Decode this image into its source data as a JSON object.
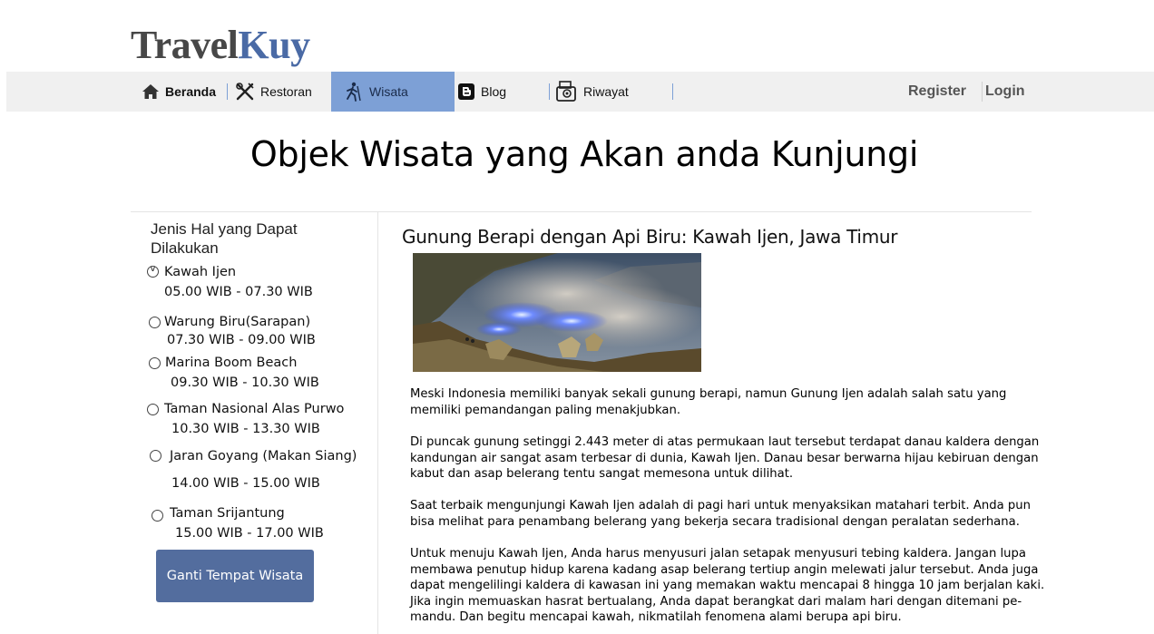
{
  "brand": {
    "first": "Travel",
    "second": "Kuy"
  },
  "nav": {
    "home": "Beranda",
    "restaurant": "Restoran",
    "tour": "Wisata",
    "blog": "Blog",
    "history": "Riwayat",
    "register": "Register",
    "login": "Login"
  },
  "page_title": "Objek Wisata yang Akan anda Kunjungi",
  "sidebar": {
    "title": "Jenis Hal yang Dapat Dilakukan",
    "items": [
      {
        "name": "Kawah Ijen",
        "time": "05.00 WIB - 07.30 WIB",
        "selected": true
      },
      {
        "name": "Warung Biru(Sarapan)",
        "time": "07.30 WIB - 09.00 WIB",
        "selected": false
      },
      {
        "name": "Marina Boom Beach",
        "time": "09.30 WIB - 10.30 WIB",
        "selected": false
      },
      {
        "name": "Taman Nasional Alas Purwo",
        "time": "10.30 WIB - 13.30 WIB",
        "selected": false
      },
      {
        "name": "Jaran Goyang (Makan Siang)",
        "time": "14.00 WIB - 15.00 WIB",
        "selected": false
      },
      {
        "name": "Taman Srijantung",
        "time": "15.00 WIB - 17.00 WIB",
        "selected": false
      }
    ],
    "button": "Ganti Tempat Wisata"
  },
  "article": {
    "title": "Gunung Berapi dengan Api Biru: Kawah Ijen, Jawa Timur",
    "paragraphs": [
      "Meski Indonesia memiliki banyak sekali gunung berapi, namun Gunung Ijen adalah salah satu yang memiliki pemandangan paling menakjubkan.",
      "Di puncak gunung setinggi 2.443 meter di atas permukaan laut tersebut terdapat danau kaldera dengan kandungan air sangat asam terbesar di dunia, Kawah Ijen. Danau besar berwarna hijau kebiruan dengan kabut dan asap belerang tentu sangat memesona untuk dilihat.",
      "Saat terbaik mengunjungi Kawah Ijen adalah di pagi hari untuk menyaksikan matahari terbit. Anda pun bisa melihat para penambang belerang yang bekerja secara tradisional dengan peralatan sederhana.",
      "Untuk menuju Kawah Ijen, Anda harus menyusuri jalan setapak menyusuri tebing kaldera. Jangan lupa membawa penutup hidup karena kadang asap belerang tertiup angin melewati jalur tersebut. Anda juga dapat mengelilingi kaldera di kawasan ini yang memakan waktu mencapai 8 hingga 10 jam berjalan kaki. Jika ingin memuaskan hasrat bertualang, Anda dapat berangkat dari malam hari dengan ditemani pe-mandu. Dan begitu mencapai kawah, nikmatilah fenomena alami berupa api biru."
    ]
  },
  "colors": {
    "nav_active": "#7da0d6",
    "button": "#536d9e",
    "logo_dark": "#474747",
    "logo_blue": "#4a6aa5"
  }
}
